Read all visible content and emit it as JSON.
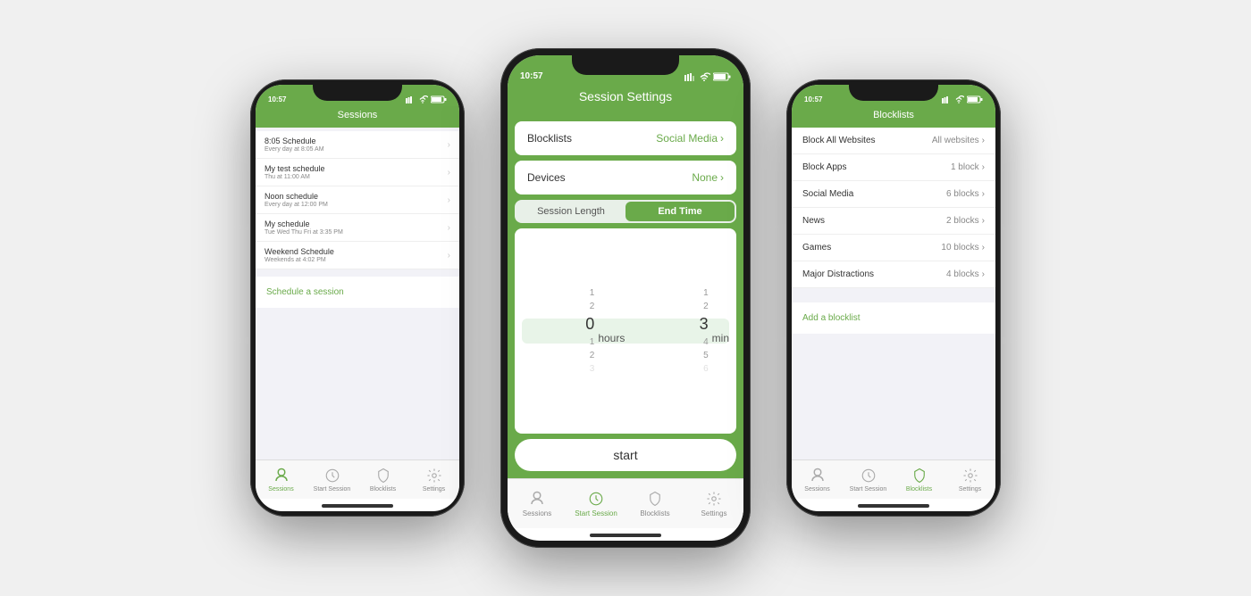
{
  "phone1": {
    "statusbar": {
      "time": "10:57",
      "icons": "●●●"
    },
    "header": {
      "title": "Sessions"
    },
    "sessions": [
      {
        "title": "8:05 Schedule",
        "subtitle": "Every day at 8:05 AM"
      },
      {
        "title": "My test schedule",
        "subtitle": "Thu at 11:00 AM"
      },
      {
        "title": "Noon schedule",
        "subtitle": "Every day at 12:00 PM"
      },
      {
        "title": "My schedule",
        "subtitle": "Tue Wed Thu Fri at 3:35 PM"
      },
      {
        "title": "Weekend Schedule",
        "subtitle": "Weekends at 4:02 PM"
      }
    ],
    "schedule_link": "Schedule a session",
    "tabs": [
      {
        "label": "Sessions",
        "active": true
      },
      {
        "label": "Start Session",
        "active": false
      },
      {
        "label": "Blocklists",
        "active": false
      },
      {
        "label": "Settings",
        "active": false
      }
    ]
  },
  "phone2": {
    "statusbar": {
      "time": "10:57"
    },
    "header": {
      "title": "Session Settings"
    },
    "blocklists_label": "Blocklists",
    "blocklists_value": "Social Media",
    "devices_label": "Devices",
    "devices_value": "None",
    "segment": {
      "left": "Session Length",
      "right": "End Time",
      "active": "right"
    },
    "picker": {
      "hours_above": [
        "",
        "1",
        "2"
      ],
      "hours_selected": "0",
      "hours_below": [
        "1",
        "2",
        "3"
      ],
      "hours_label": "hours",
      "mins_above": [
        "",
        "1",
        "2"
      ],
      "mins_selected": "3",
      "mins_below": [
        "4",
        "5",
        "6"
      ],
      "mins_label": "min"
    },
    "start_btn": "start",
    "tabs": [
      {
        "label": "Sessions",
        "active": false
      },
      {
        "label": "Start Session",
        "active": true
      },
      {
        "label": "Blocklists",
        "active": false
      },
      {
        "label": "Settings",
        "active": false
      }
    ]
  },
  "phone3": {
    "statusbar": {
      "time": "10:57"
    },
    "header": {
      "title": "Blocklists"
    },
    "blocklists": [
      {
        "name": "Block All Websites",
        "value": "All websites"
      },
      {
        "name": "Block Apps",
        "value": "1 block"
      },
      {
        "name": "Social Media",
        "value": "6 blocks"
      },
      {
        "name": "News",
        "value": "2 blocks"
      },
      {
        "name": "Games",
        "value": "10 blocks"
      },
      {
        "name": "Major Distractions",
        "value": "4 blocks"
      }
    ],
    "add_label": "Add a blocklist",
    "tabs": [
      {
        "label": "Sessions",
        "active": false
      },
      {
        "label": "Start Session",
        "active": false
      },
      {
        "label": "Blocklists",
        "active": true
      },
      {
        "label": "Settings",
        "active": false
      }
    ]
  },
  "colors": {
    "green": "#6aaa4a",
    "green_light": "#e8f4e8"
  }
}
